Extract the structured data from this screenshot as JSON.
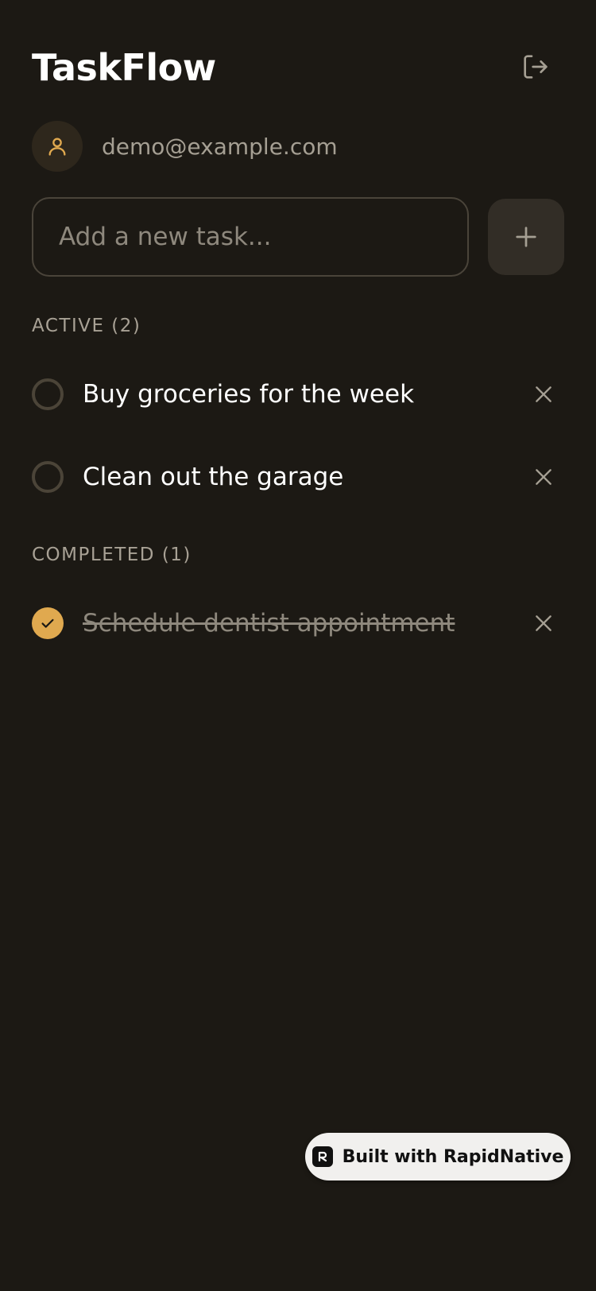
{
  "header": {
    "title": "TaskFlow",
    "logout_icon": "logout-icon"
  },
  "user": {
    "email": "demo@example.com",
    "avatar_icon": "user-icon"
  },
  "new_task": {
    "placeholder": "Add a new task...",
    "value": "",
    "add_icon": "plus-icon"
  },
  "active": {
    "header": "ACTIVE (2)",
    "tasks": [
      {
        "text": "Buy groceries for the week",
        "done": false
      },
      {
        "text": "Clean out the garage",
        "done": false
      }
    ]
  },
  "completed": {
    "header": "COMPLETED (1)",
    "tasks": [
      {
        "text": "Schedule dentist appointment",
        "done": true
      }
    ]
  },
  "badge": {
    "label": "Built with RapidNative",
    "icon": "rapidnative-logo-icon"
  },
  "colors": {
    "background": "#1c1914",
    "accent": "#e0a94f",
    "muted_text": "#a59f93",
    "badge_bg": "#f1f0ee"
  }
}
